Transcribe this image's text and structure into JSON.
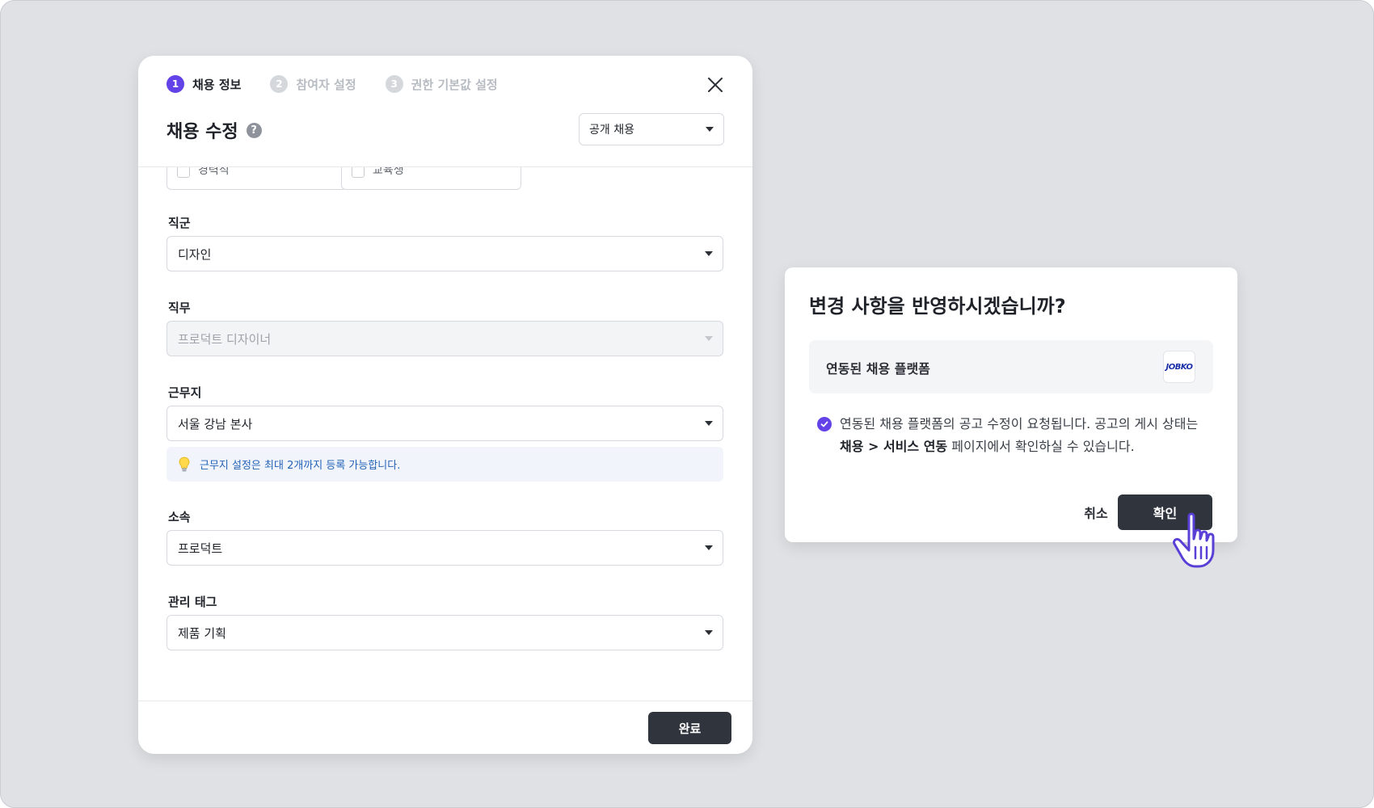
{
  "stepper": {
    "steps": [
      {
        "num": "1",
        "label": "채용 정보",
        "state": "active"
      },
      {
        "num": "2",
        "label": "참여자 설정",
        "state": "inactive"
      },
      {
        "num": "3",
        "label": "권한 기본값 설정",
        "state": "inactive"
      }
    ]
  },
  "modal": {
    "title": "채용 수정",
    "help_glyph": "?",
    "type_select": "공개 채용",
    "partial_checkboxes": [
      "경력직",
      "교육생"
    ],
    "fields": {
      "job_group": {
        "label": "직군",
        "value": "디자인"
      },
      "job_role": {
        "label": "직무",
        "value": "프로덕트 디자이너"
      },
      "location": {
        "label": "근무지",
        "value": "서울 강남 본사"
      },
      "location_hint": "근무지 설정은 최대 2개까지 등록 가능합니다.",
      "affiliation": {
        "label": "소속",
        "value": "프로덕트"
      },
      "tags": {
        "label": "관리 태그",
        "value": "제품 기획"
      }
    },
    "done_label": "완료"
  },
  "confirm": {
    "title": "변경 사항을 반영하시겠습니까?",
    "platform_label": "연동된 채용 플랫폼",
    "platform_logo": "JOBKO",
    "notice_prefix": "연동된 채용 플랫폼의 공고 수정이 요청됩니다. 공고의 게시 상태는 ",
    "notice_bold": "채용 > 서비스 연동",
    "notice_suffix": " 페이지에서 확인하실 수 있습니다.",
    "cancel_label": "취소",
    "ok_label": "확인"
  },
  "colors": {
    "accent": "#6343e8",
    "dark_button": "#2f343d",
    "hint_text": "#2463b8",
    "background": "#dfe1e5"
  },
  "icons": [
    "close-icon",
    "help-icon",
    "chevron-down-icon",
    "lightbulb-icon",
    "check-circle-icon",
    "pointer-hand-icon"
  ]
}
